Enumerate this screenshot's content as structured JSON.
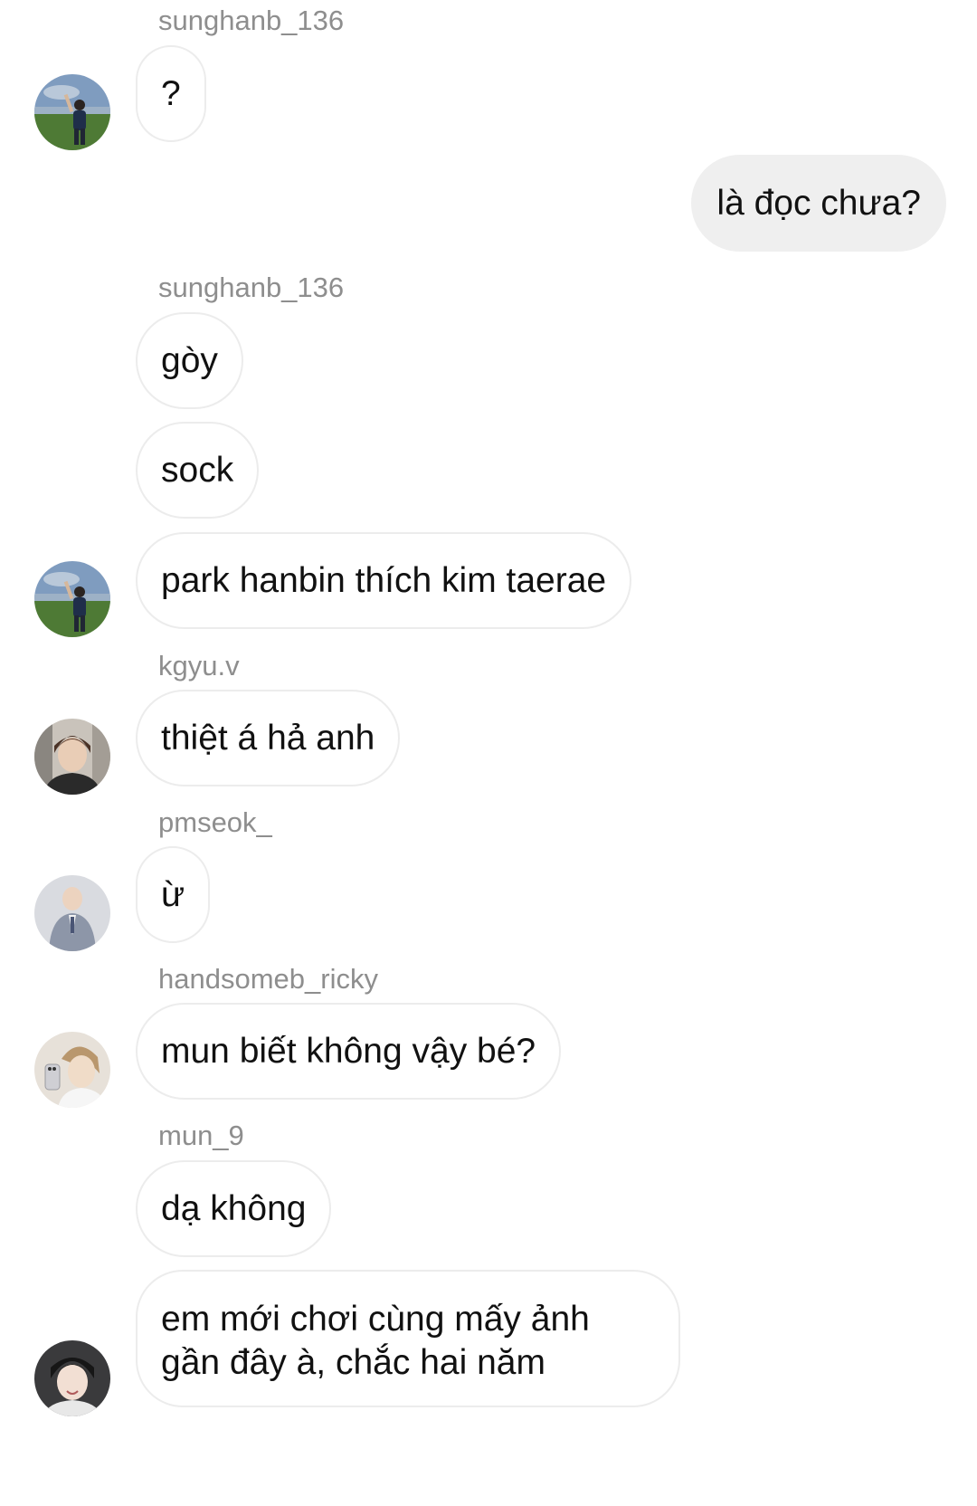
{
  "messages": [
    {
      "sender": "sunghanb_136",
      "text": "?"
    },
    {
      "sender": "me",
      "text": "là đọc chưa?"
    },
    {
      "sender": "sunghanb_136",
      "texts": [
        "gòy",
        "sock",
        "park hanbin thích kim taerae"
      ]
    },
    {
      "sender": "kgyu.v",
      "text": "thiệt á hả anh"
    },
    {
      "sender": "pmseok_",
      "text": "ừ"
    },
    {
      "sender": "handsomeb_ricky",
      "text": "mun biết không vậy bé?"
    },
    {
      "sender": "mun_9",
      "texts": [
        "dạ không",
        "em mới chơi cùng mấy ảnh gần đây à, chắc hai năm"
      ]
    }
  ],
  "long_message_lines": [
    "em mới chơi cùng mấy ảnh",
    "gần đây à, chắc hai năm"
  ],
  "colors": {
    "background": "#ffffff",
    "incoming_border": "#ececec",
    "outgoing_bubble": "#efefef",
    "username_text": "#8e8e8e",
    "message_text": "#111111"
  },
  "avatars": [
    "field-photo-avatar",
    "field-photo-avatar",
    "portrait-avatar",
    "suit-portrait-avatar",
    "selfie-avatar",
    "portrait-avatar"
  ]
}
